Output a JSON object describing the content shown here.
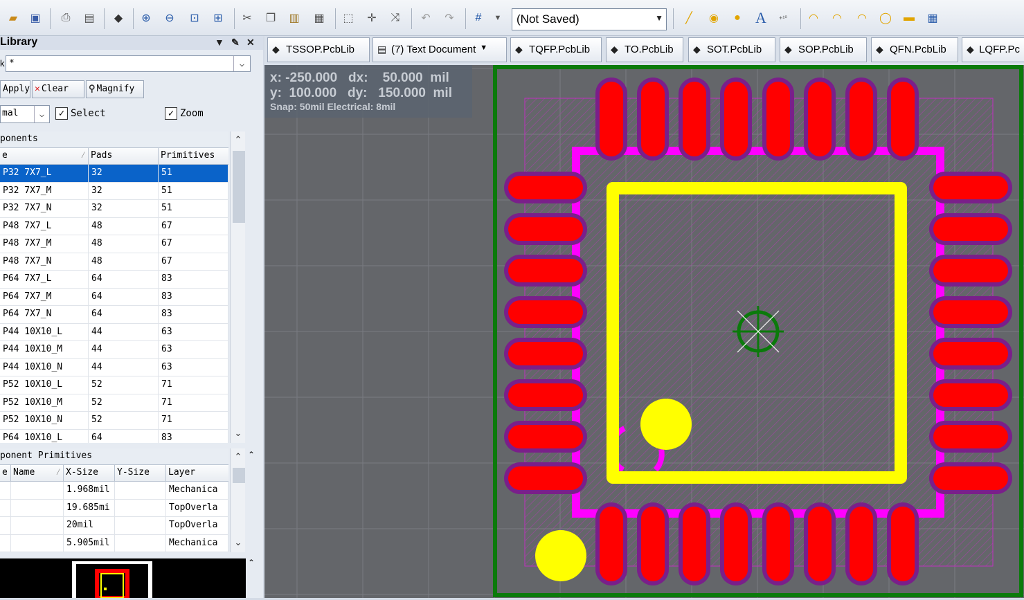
{
  "toolbar": {
    "state_combo": "(Not Saved)",
    "icons": [
      "open-icon",
      "save-icon",
      "print-icon",
      "print-preview-icon",
      "3d-body-icon",
      "zoom-in-icon",
      "zoom-out-icon",
      "zoom-fit-icon",
      "zoom-selection-icon",
      "cut-icon",
      "copy-icon",
      "paste-icon",
      "rubber-stamp-icon",
      "select-area-icon",
      "move-icon",
      "cross-probe-icon",
      "undo-icon",
      "redo-icon",
      "grid-icon",
      "line-icon",
      "pad-icon",
      "via-icon",
      "string-icon",
      "coordinate-icon",
      "arc-center-icon",
      "arc-edge-icon",
      "arc-any-icon",
      "circle-icon",
      "fill-icon",
      "array-paste-icon"
    ]
  },
  "panel": {
    "title": "Library",
    "mask_label": "k",
    "mask_value": "*",
    "apply_label": "Apply",
    "clear_label": "Clear",
    "magnify_label": "Magnify",
    "mode_value": "mal",
    "select_label": "Select",
    "zoom_label": "Zoom",
    "components_title": "ponents",
    "components_columns": [
      "e",
      "Pads",
      "Primitives"
    ],
    "components": [
      {
        "name": "P32 7X7_L",
        "pads": "32",
        "prims": "51"
      },
      {
        "name": "P32 7X7_M",
        "pads": "32",
        "prims": "51"
      },
      {
        "name": "P32 7X7_N",
        "pads": "32",
        "prims": "51"
      },
      {
        "name": "P48 7X7_L",
        "pads": "48",
        "prims": "67"
      },
      {
        "name": "P48 7X7_M",
        "pads": "48",
        "prims": "67"
      },
      {
        "name": "P48 7X7_N",
        "pads": "48",
        "prims": "67"
      },
      {
        "name": "P64 7X7_L",
        "pads": "64",
        "prims": "83"
      },
      {
        "name": "P64 7X7_M",
        "pads": "64",
        "prims": "83"
      },
      {
        "name": "P64 7X7_N",
        "pads": "64",
        "prims": "83"
      },
      {
        "name": "P44 10X10_L",
        "pads": "44",
        "prims": "63"
      },
      {
        "name": "P44 10X10_M",
        "pads": "44",
        "prims": "63"
      },
      {
        "name": "P44 10X10_N",
        "pads": "44",
        "prims": "63"
      },
      {
        "name": "P52 10X10_L",
        "pads": "52",
        "prims": "71"
      },
      {
        "name": "P52 10X10_M",
        "pads": "52",
        "prims": "71"
      },
      {
        "name": "P52 10X10_N",
        "pads": "52",
        "prims": "71"
      },
      {
        "name": "P64 10X10_L",
        "pads": "64",
        "prims": "83"
      }
    ],
    "primitives_title": "ponent Primitives",
    "primitives_columns": [
      "e",
      "Name",
      "X-Size",
      "Y-Size",
      "Layer"
    ],
    "primitives": [
      {
        "xsize": "1.968mil",
        "layer": "Mechanica"
      },
      {
        "xsize": "19.685mi",
        "layer": "TopOverla"
      },
      {
        "xsize": "20mil",
        "layer": "TopOverla"
      },
      {
        "xsize": "5.905mil",
        "layer": "Mechanica"
      }
    ]
  },
  "tabs": [
    {
      "label": "TSSOP.PcbLib"
    },
    {
      "label": "(7) Text Document"
    },
    {
      "label": "TQFP.PcbLib"
    },
    {
      "label": "TO.PcbLib"
    },
    {
      "label": "SOT.PcbLib"
    },
    {
      "label": "SOP.PcbLib"
    },
    {
      "label": "QFN.PcbLib"
    },
    {
      "label": "LQFP.Pc"
    }
  ],
  "coords": {
    "x_line": "x: -250.000   dx:    50.000  mil",
    "y_line": "y:  100.000   dy:   150.000  mil",
    "snap_line": "Snap: 50mil Electrical: 8mil"
  },
  "colors": {
    "canvas": "#64666a",
    "pad": "#ff0000",
    "pad_mask": "#7a1f8a",
    "courtyard": "#ff00ff",
    "overlay": "#ffff00",
    "board_outline": "#0b7a0b",
    "selection": "#0a63c9"
  }
}
